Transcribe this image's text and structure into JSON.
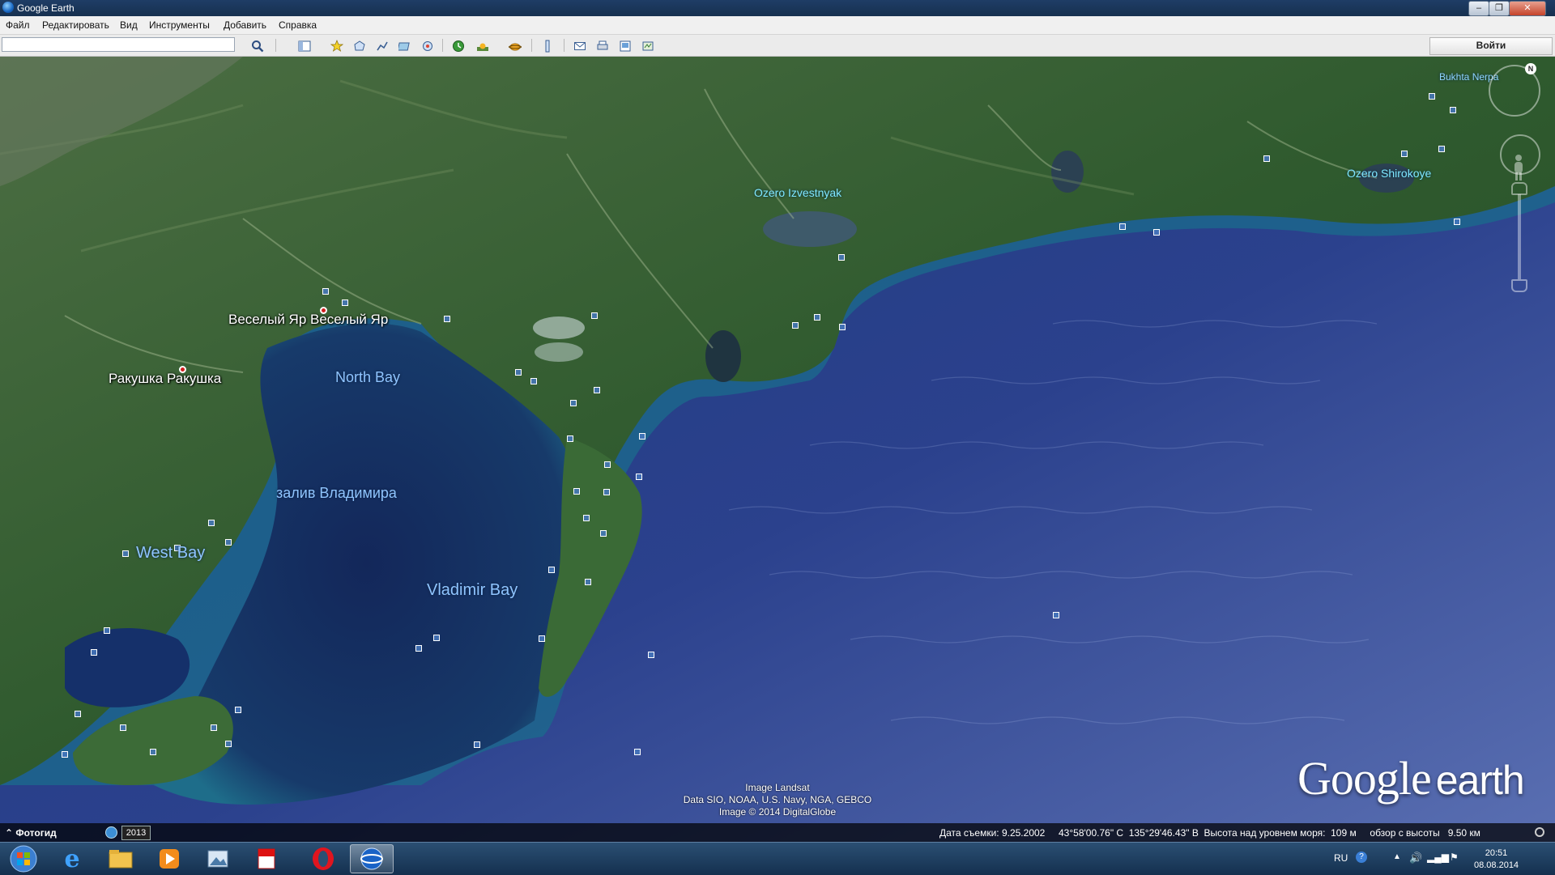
{
  "window": {
    "title": "Google Earth",
    "btn_min": "–",
    "btn_max": "❐",
    "btn_close": "✕"
  },
  "menu": [
    "Файл",
    "Редактировать",
    "Вид",
    "Инструменты",
    "Добавить",
    "Справка"
  ],
  "toolbar": {
    "search_value": "",
    "signin_label": "Войти",
    "icons": [
      "search-icon",
      "sidebar-toggle-icon",
      "placemark-icon",
      "polygon-icon",
      "path-icon",
      "image-overlay-icon",
      "tour-icon",
      "historical-imagery-icon",
      "sunlight-icon",
      "sky-icon",
      "ruler-icon",
      "email-icon",
      "print-icon",
      "save-image-icon",
      "maps-icon"
    ]
  },
  "map": {
    "places": {
      "vesely_yar": "Веселый Яр Веселый Яр",
      "rakushka": "Ракушка Ракушка",
      "north_bay": "North Bay",
      "zaliv_vladimira": "залив Владимира",
      "west_bay": "West Bay",
      "vladimir_bay": "Vladimir Bay",
      "ozero_izvestnyak": "Ozero Izvestnyak",
      "ozero_shirokoye": "Ozero Shirokoye",
      "bukhta_nerpa": "Bukhta Nerpa"
    },
    "attribution": [
      "Image Landsat",
      "Data SIO, NOAA, U.S. Navy, NGA, GEBCO",
      "Image © 2014 DigitalGlobe"
    ],
    "logo_google": "Google",
    "logo_earth": "earth",
    "north_label": "N"
  },
  "status": {
    "photo_guide": "⌃ Фотогид",
    "year": "2013",
    "info": "Дата съемки: 9.25.2002     43°58'00.76\" С  135°29'46.43\" В  Высота над уровнем моря:  109 м     обзор с высоты   9.50 км"
  },
  "taskbar": {
    "apps": [
      "start-icon",
      "internet-explorer-icon",
      "file-explorer-icon",
      "media-player-icon",
      "photo-app-icon",
      "adobe-reader-icon",
      "opera-icon",
      "google-earth-icon"
    ],
    "lang": "RU",
    "time": "20:51",
    "date": "08.08.2014"
  },
  "colors": {
    "land": "#2f5a2e",
    "sea": "#2a3f86",
    "shallow": "#1d6f8a",
    "bay_label": "#8fc4ff",
    "lake_label": "#7fe7ff"
  }
}
